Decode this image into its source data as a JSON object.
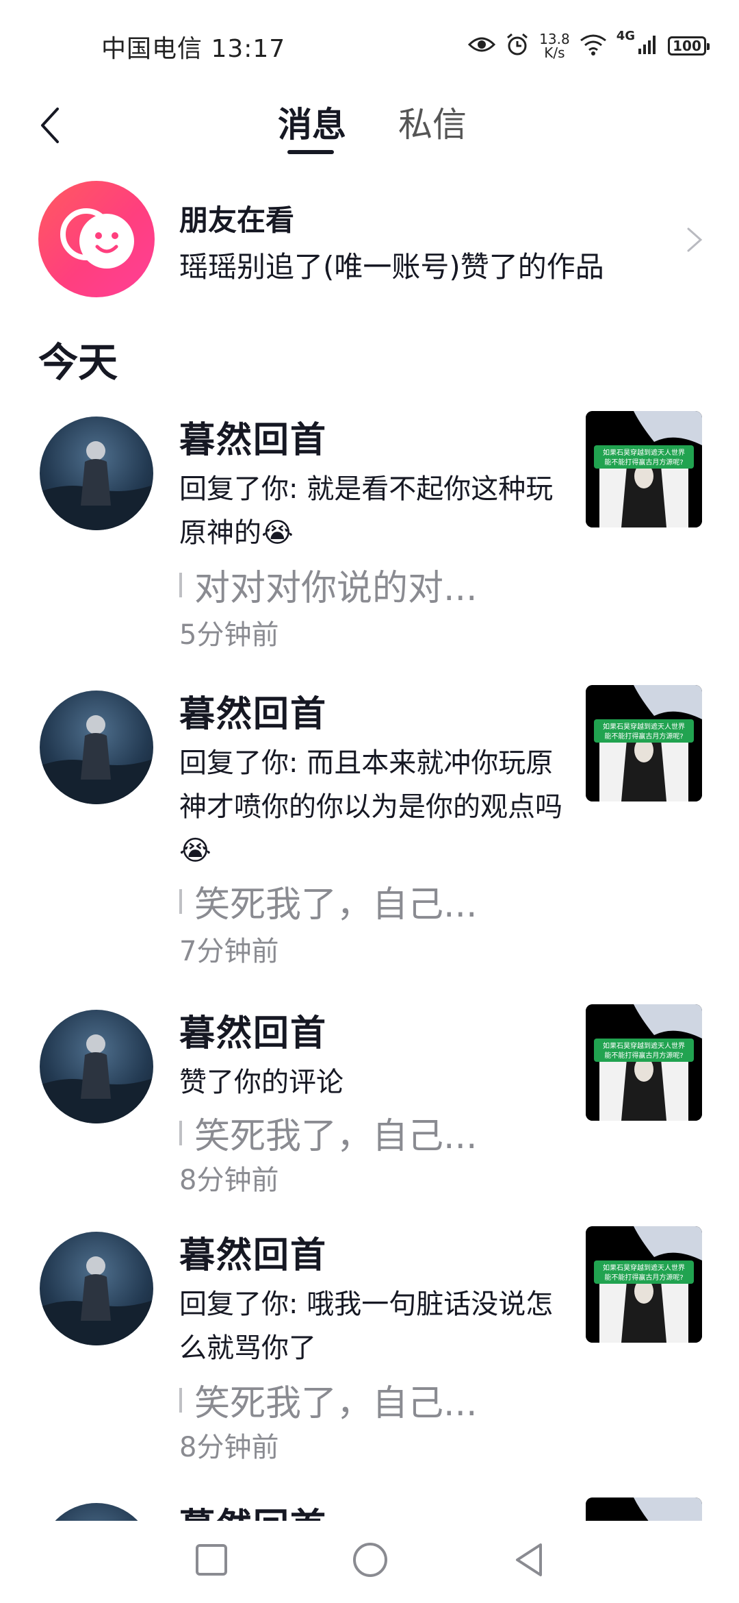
{
  "status_bar": {
    "carrier_time": "中国电信 13:17",
    "net_speed_value": "13.8",
    "net_speed_unit": "K/s",
    "network_type": "4G",
    "battery": "100"
  },
  "nav": {
    "tabs": [
      {
        "label": "消息",
        "active": true
      },
      {
        "label": "私信",
        "active": false
      }
    ]
  },
  "friends": {
    "title": "朋友在看",
    "subtitle": "瑶瑶别追了(唯一账号)赞了的作品"
  },
  "section_title": "今天",
  "notifications": [
    {
      "username": "暮然回首",
      "action": "回复了你: 就是看不起你这种玩原神的😭",
      "quote": "对对对你说的对...",
      "time": "5分钟前"
    },
    {
      "username": "暮然回首",
      "action": "回复了你: 而且本来就冲你玩原神才喷你的你以为是你的观点吗😭",
      "quote": "笑死我了，自己...",
      "time": "7分钟前"
    },
    {
      "username": "暮然回首",
      "action": "赞了你的评论",
      "quote": "笑死我了，自己...",
      "time": "8分钟前"
    },
    {
      "username": "暮然回首",
      "action": "回复了你: 哦我一句脏话没说怎么就骂你了",
      "quote": "笑死我了，自己...",
      "time": "8分钟前"
    },
    {
      "username": "暮然回首"
    }
  ],
  "thumbnail_caption": {
    "line1": "如果石昊穿越到遮天人世界",
    "line2": "能不能打得赢古月方源呢?"
  },
  "colors": {
    "accent_pink": "#ff3f7e",
    "text_primary": "#161823",
    "text_secondary": "#8a8b91"
  }
}
